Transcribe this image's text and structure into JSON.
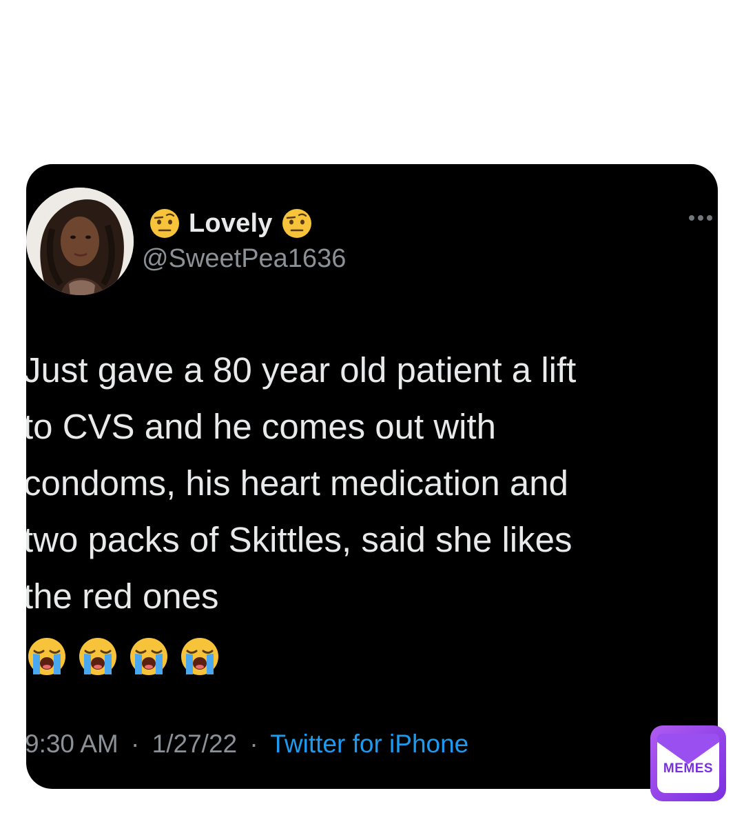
{
  "tweet": {
    "display_name": "Lovely",
    "name_emoji_icon": "face-with-raised-eyebrow-icon",
    "handle": "@SweetPea1636",
    "text": "Just gave a 80 year old patient a lift\nto CVS and he comes out with\ncondoms, his heart medication and\ntwo packs of Skittles, said she likes\nthe red ones",
    "emoji_row": [
      "loudly-crying-face-icon",
      "loudly-crying-face-icon",
      "loudly-crying-face-icon",
      "loudly-crying-face-icon"
    ],
    "time": "9:30 AM",
    "date": "1/27/22",
    "separator": "·",
    "source": "Twitter for iPhone",
    "more_icon": "more-options-icon"
  },
  "watermark": {
    "label": "MEMES",
    "icon": "envelope-icon"
  },
  "colors": {
    "card_background": "#000000",
    "primary_text": "#e7e9ea",
    "secondary_text": "#8b9196",
    "link": "#1d9bf0",
    "badge": "#7a2fe0"
  }
}
